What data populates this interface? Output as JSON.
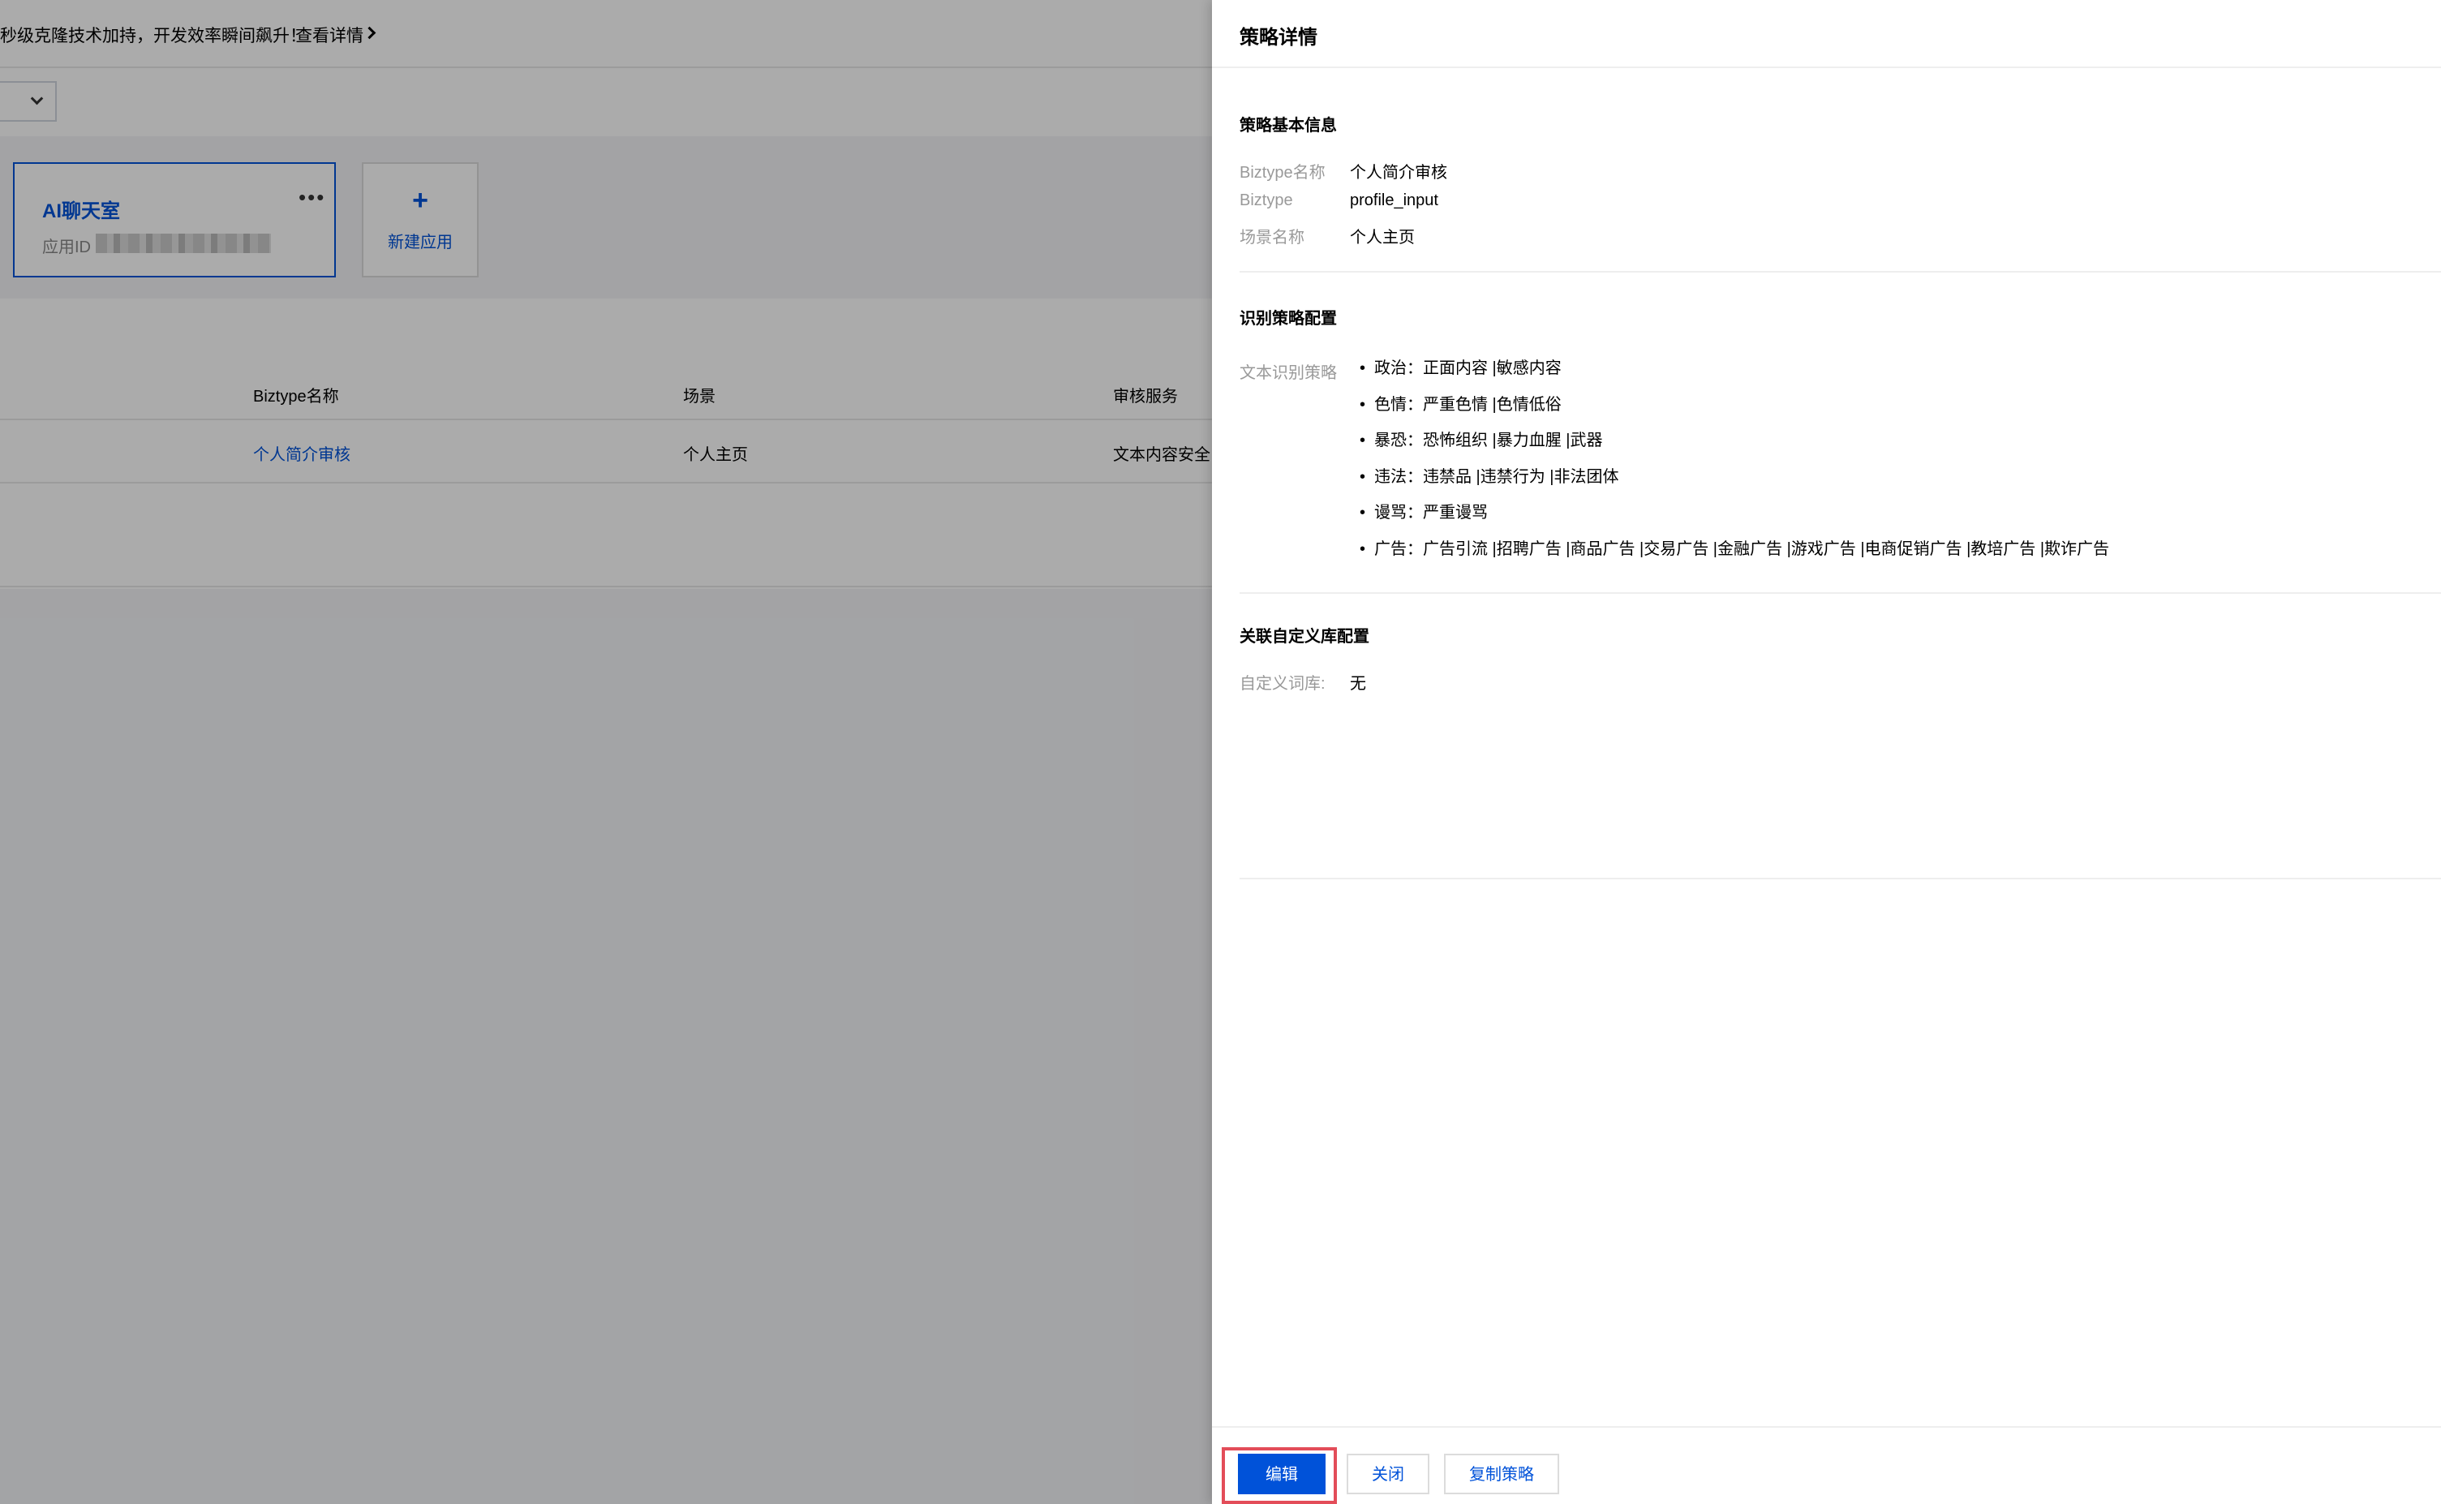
{
  "background": {
    "banner": {
      "text": "秒级克隆技术加持，开发效率瞬间飙升！",
      "link_label": "查看详情"
    },
    "app_card": {
      "name": "AI聊天室",
      "id_label": "应用ID"
    },
    "new_app_label": "新建应用",
    "table": {
      "headers": [
        "Biztype名称",
        "场景",
        "审核服务"
      ],
      "rows": [
        [
          "个人简介审核",
          "个人主页",
          "文本内容安全"
        ]
      ]
    }
  },
  "drawer": {
    "title": "策略详情",
    "basic_info": {
      "title": "策略基本信息",
      "fields": [
        {
          "label": "Biztype名称",
          "value": "个人简介审核"
        },
        {
          "label": "Biztype",
          "value": "profile_input"
        },
        {
          "label": "场景名称",
          "value": "个人主页"
        }
      ]
    },
    "recognition": {
      "title": "识别策略配置",
      "label": "文本识别策略",
      "items": [
        "政治：正面内容 |敏感内容",
        "色情：严重色情 |色情低俗",
        "暴恐：恐怖组织 |暴力血腥 |武器",
        "违法：违禁品 |违禁行为 |非法团体",
        "谩骂：严重谩骂",
        "广告：广告引流 |招聘广告 |商品广告 |交易广告 |金融广告 |游戏广告 |电商促销广告 |教培广告 |欺诈广告"
      ]
    },
    "custom_lib": {
      "title": "关联自定义库配置",
      "label": "自定义词库:",
      "value": "无"
    },
    "footer": {
      "edit_label": "编辑",
      "close_label": "关闭",
      "copy_label": "复制策略"
    }
  },
  "colors": {
    "brand": "#0052d9",
    "highlight": "#e34d59"
  }
}
